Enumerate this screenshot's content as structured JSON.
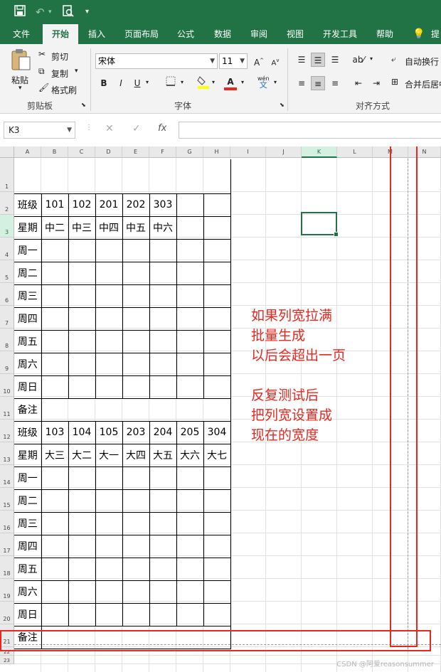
{
  "quick_access": {
    "icons": [
      "save-icon",
      "undo-icon",
      "print-preview-icon",
      "customize-qat-icon"
    ]
  },
  "tabs": [
    "文件",
    "开始",
    "插入",
    "页面布局",
    "公式",
    "数据",
    "审阅",
    "视图",
    "开发工具",
    "帮助",
    "提"
  ],
  "ribbon": {
    "paste": "粘贴",
    "cut": "剪切",
    "copy": "复制",
    "format_painter": "格式刷",
    "clipboard_label": "剪贴板",
    "font_name": "宋体",
    "font_size": "11",
    "font_label": "字体",
    "bold": "B",
    "italic": "I",
    "underline": "U",
    "font_color": "A",
    "wen": "wén",
    "wen_char": "文",
    "wrap_text": "自动换行",
    "merge_center": "合并后居中",
    "align_label": "对齐方式"
  },
  "formula_bar": {
    "name_box": "K3",
    "fx": "fx",
    "formula": ""
  },
  "columns": [
    "A",
    "B",
    "C",
    "D",
    "E",
    "F",
    "G",
    "H",
    "I",
    "J",
    "K",
    "L",
    "M",
    "N"
  ],
  "rows": [
    "1",
    "2",
    "3",
    "4",
    "5",
    "6",
    "7",
    "8",
    "9",
    "10",
    "11",
    "12",
    "13",
    "14",
    "15",
    "16",
    "17",
    "18",
    "19",
    "20",
    "21",
    "22",
    "23"
  ],
  "table1": {
    "class_label": "班级",
    "classes": [
      "101",
      "102",
      "201",
      "202",
      "303",
      "",
      ""
    ],
    "week_label": "星期",
    "weeks": [
      "中二",
      "中三",
      "中四",
      "中五",
      "中六",
      "",
      ""
    ]
  },
  "table2": {
    "class_label": "班级",
    "classes": [
      "103",
      "104",
      "105",
      "203",
      "204",
      "205",
      "304"
    ],
    "week_label": "星期",
    "weeks": [
      "大三",
      "大二",
      "大一",
      "大四",
      "大五",
      "大六",
      "大七"
    ]
  },
  "days": [
    "周一",
    "周二",
    "周三",
    "周四",
    "周五",
    "周六",
    "周日"
  ],
  "remark": "备注",
  "annotation": {
    "lines": [
      "如果列宽拉满",
      "批量生成",
      "以后会超出一页",
      "",
      "反复测试后",
      "把列宽设置成",
      "现在的宽度"
    ]
  },
  "watermark": "CSDN @阿爱reasonsummer",
  "colors": {
    "excel_green": "#217346",
    "annotation_red": "#e8271f"
  }
}
